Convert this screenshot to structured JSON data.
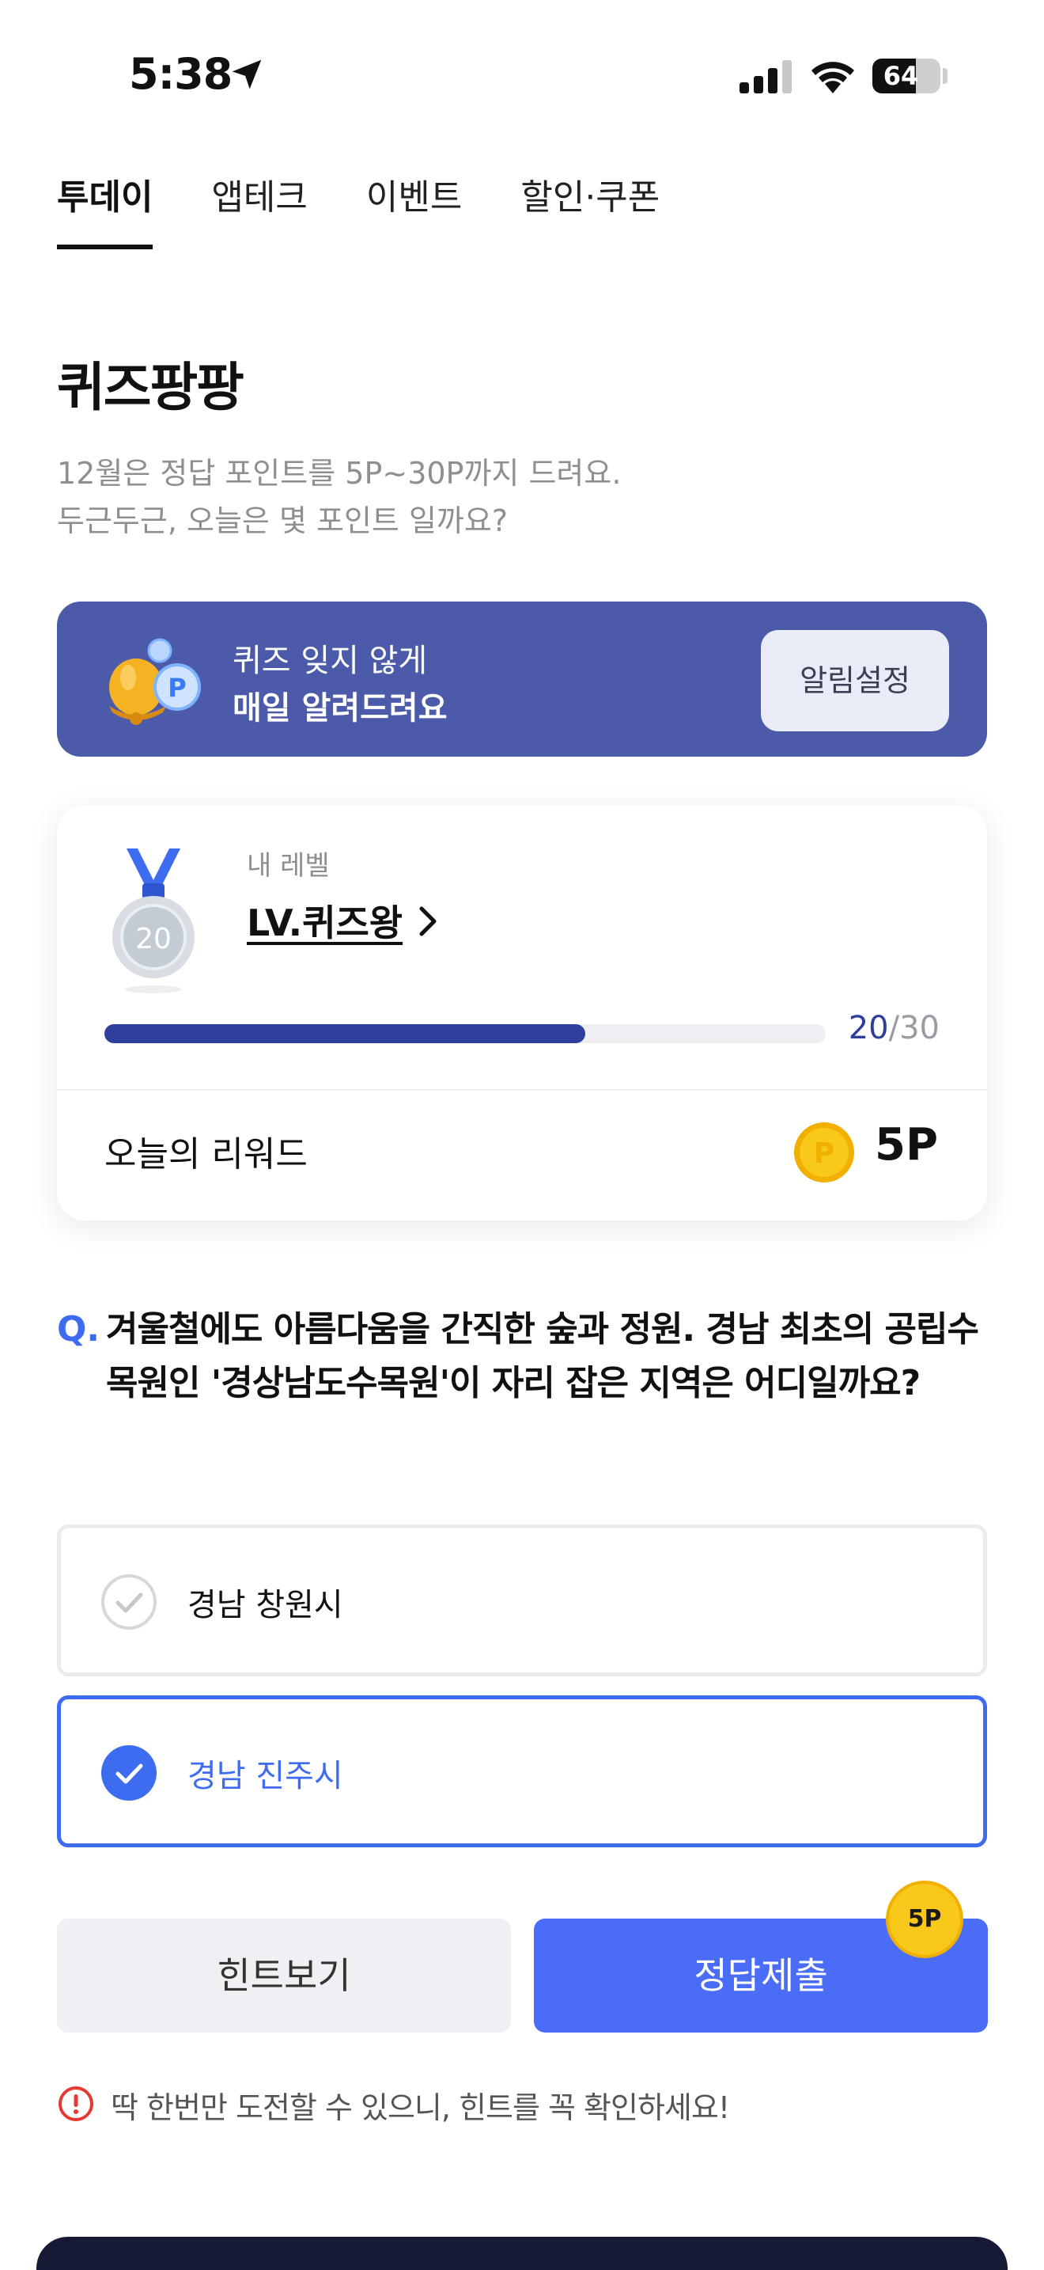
{
  "status_bar": {
    "time": "5:38",
    "battery": "64",
    "battery_level": 0.64
  },
  "tabs": [
    {
      "label": "투데이",
      "active": true
    },
    {
      "label": "앱테크",
      "active": false
    },
    {
      "label": "이벤트",
      "active": false
    },
    {
      "label": "할인·쿠폰",
      "active": false
    }
  ],
  "page": {
    "title": "퀴즈팡팡",
    "subtitle_line1": "12월은 정답 포인트를 5P~30P까지 드려요.",
    "subtitle_line2": "두근두근, 오늘은 몇 포인트 일까요?"
  },
  "banner": {
    "line1": "퀴즈 잊지 않게",
    "line2": "매일 알려드려요",
    "button_label": "알림설정",
    "icon": "bell-icon",
    "background": "#4b5aa9"
  },
  "level": {
    "medal_number": "20",
    "caption": "내 레벨",
    "name": "LV.퀴즈왕",
    "progress_current": "20",
    "progress_total": "/30",
    "progress_fraction": 0.667
  },
  "reward": {
    "label": "오늘의 리워드",
    "value": "5P"
  },
  "question": {
    "prefix": "Q.",
    "text": "겨울철에도 아름다움을 간직한 숲과 정원. 경남 최초의 공립수목원인 '경상남도수목원'이 자리 잡은 지역은 어디일까요?"
  },
  "options": [
    {
      "label": "경남 창원시",
      "selected": false
    },
    {
      "label": "경남 진주시",
      "selected": true
    }
  ],
  "actions": {
    "hint_label": "힌트보기",
    "submit_label": "정답제출",
    "badge": "5P"
  },
  "warning": "딱 한번만 도전할 수 있으니, 힌트를 꼭 확인하세요!",
  "colors": {
    "accent": "#4a6cf7",
    "progress": "#2f3f9c",
    "coin": "#f8c81a"
  }
}
